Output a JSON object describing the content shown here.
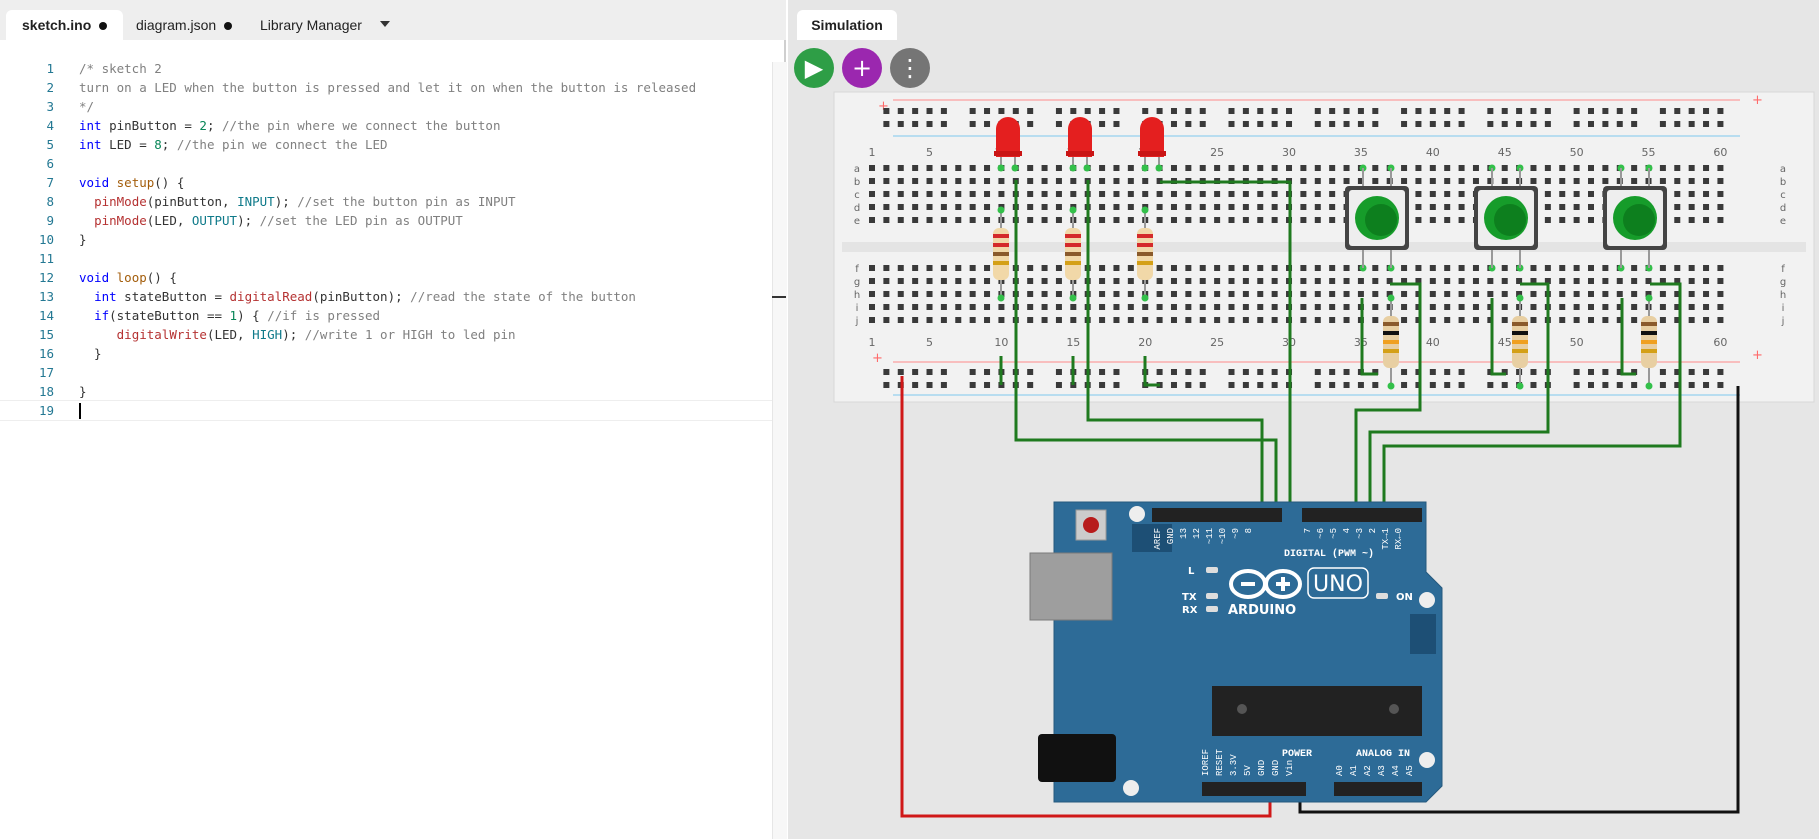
{
  "editor": {
    "tabs": [
      {
        "label": "sketch.ino",
        "modified": true
      },
      {
        "label": "diagram.json",
        "modified": true
      },
      {
        "label": "Library Manager",
        "modified": false
      }
    ],
    "lines": [
      [
        [
          "c-com",
          "/* sketch 2"
        ]
      ],
      [
        [
          "c-com",
          "turn on a LED when the button is pressed and let it on when the button is released"
        ]
      ],
      [
        [
          "c-com",
          "*/"
        ]
      ],
      [
        [
          "c-kw",
          "int"
        ],
        [
          "c-pl",
          " pinButton = "
        ],
        [
          "c-num",
          "2"
        ],
        [
          "c-pl",
          "; "
        ],
        [
          "c-com",
          "//the pin where we connect the button"
        ]
      ],
      [
        [
          "c-kw",
          "int"
        ],
        [
          "c-pl",
          " LED = "
        ],
        [
          "c-num",
          "8"
        ],
        [
          "c-pl",
          "; "
        ],
        [
          "c-com",
          "//the pin we connect the LED"
        ]
      ],
      [],
      [
        [
          "c-kw",
          "void"
        ],
        [
          "c-pl",
          " "
        ],
        [
          "c-fn",
          "setup"
        ],
        [
          "c-pl",
          "() {"
        ]
      ],
      [
        [
          "c-pl",
          "  "
        ],
        [
          "c-rd",
          "pinMode"
        ],
        [
          "c-pl",
          "(pinButton, "
        ],
        [
          "c-const",
          "INPUT"
        ],
        [
          "c-pl",
          "); "
        ],
        [
          "c-com",
          "//set the button pin as INPUT"
        ]
      ],
      [
        [
          "c-pl",
          "  "
        ],
        [
          "c-rd",
          "pinMode"
        ],
        [
          "c-pl",
          "(LED, "
        ],
        [
          "c-const",
          "OUTPUT"
        ],
        [
          "c-pl",
          "); "
        ],
        [
          "c-com",
          "//set the LED pin as OUTPUT"
        ]
      ],
      [
        [
          "c-pl",
          "}"
        ]
      ],
      [],
      [
        [
          "c-kw",
          "void"
        ],
        [
          "c-pl",
          " "
        ],
        [
          "c-fn",
          "loop"
        ],
        [
          "c-pl",
          "() {"
        ]
      ],
      [
        [
          "c-pl",
          "  "
        ],
        [
          "c-kw",
          "int"
        ],
        [
          "c-pl",
          " stateButton = "
        ],
        [
          "c-rd",
          "digitalRead"
        ],
        [
          "c-pl",
          "(pinButton); "
        ],
        [
          "c-com",
          "//read the state of the button"
        ]
      ],
      [
        [
          "c-pl",
          "  "
        ],
        [
          "c-kw",
          "if"
        ],
        [
          "c-pl",
          "(stateButton == "
        ],
        [
          "c-num",
          "1"
        ],
        [
          "c-pl",
          ") { "
        ],
        [
          "c-com",
          "//if is pressed"
        ]
      ],
      [
        [
          "c-pl",
          "     "
        ],
        [
          "c-rd",
          "digitalWrite"
        ],
        [
          "c-pl",
          "(LED, "
        ],
        [
          "c-const",
          "HIGH"
        ],
        [
          "c-pl",
          "); "
        ],
        [
          "c-com",
          "//write 1 or HIGH to led pin"
        ]
      ],
      [
        [
          "c-pl",
          "  }"
        ]
      ],
      [],
      [
        [
          "c-pl",
          "}"
        ]
      ],
      []
    ]
  },
  "simulation": {
    "tab_label": "Simulation",
    "buttons": {
      "play": "▶",
      "add": "+",
      "more": "⋮"
    },
    "breadboard": {
      "column_labels": [
        "1",
        "5",
        "10",
        "15",
        "20",
        "25",
        "30",
        "35",
        "40",
        "45",
        "50",
        "55",
        "60"
      ],
      "row_labels_top": [
        "a",
        "b",
        "c",
        "d",
        "e"
      ],
      "row_labels_bottom": [
        "f",
        "g",
        "h",
        "i",
        "j"
      ],
      "plus_label": "+"
    },
    "arduino": {
      "brand": "ARDUINO",
      "model": "UNO",
      "digital_label": "DIGITAL (PWM ~)",
      "digital_pins": [
        "AREF",
        "GND",
        "13",
        "12",
        "~11",
        "~10",
        "~9",
        "8",
        "7",
        "~6",
        "~5",
        "4",
        "~3",
        "2",
        "TX→1",
        "RX←0"
      ],
      "power_label": "POWER",
      "power_pins": [
        "IOREF",
        "RESET",
        "3.3V",
        "5V",
        "GND",
        "GND",
        "Vin"
      ],
      "analog_label": "ANALOG IN",
      "analog_pins": [
        "A0",
        "A1",
        "A2",
        "A3",
        "A4",
        "A5"
      ],
      "led_labels": {
        "l": "L",
        "tx": "TX",
        "rx": "RX",
        "on": "ON"
      }
    },
    "colors": {
      "wire_green": "#1f7a1f",
      "wire_red": "#d01818",
      "wire_black": "#111111",
      "board_blue": "#2d6b97",
      "led_red": "#e41f1f",
      "button_green": "#169c2a"
    }
  }
}
